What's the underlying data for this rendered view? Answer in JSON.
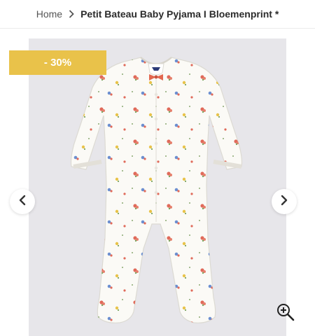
{
  "breadcrumb": {
    "home": "Home",
    "current": "Petit Bateau Baby Pyjama I Bloemenprint *",
    "separator_icon": "chevron-right-icon"
  },
  "product_gallery": {
    "discount_badge": "- 30%",
    "image_alt": "Petit Bateau Baby Pyjama I Bloemenprint",
    "prev_icon": "chevron-left-icon",
    "next_icon": "chevron-right-icon",
    "zoom_icon": "zoom-in-icon"
  },
  "colors": {
    "badge": "#e9c24a",
    "gallery_background": "#e7e6ea",
    "garment": "#fbfaf6",
    "print_red": "#e06a5a",
    "print_yellow": "#e8c34a",
    "print_blue": "#6c8fd0",
    "bow": "#e2674f"
  }
}
